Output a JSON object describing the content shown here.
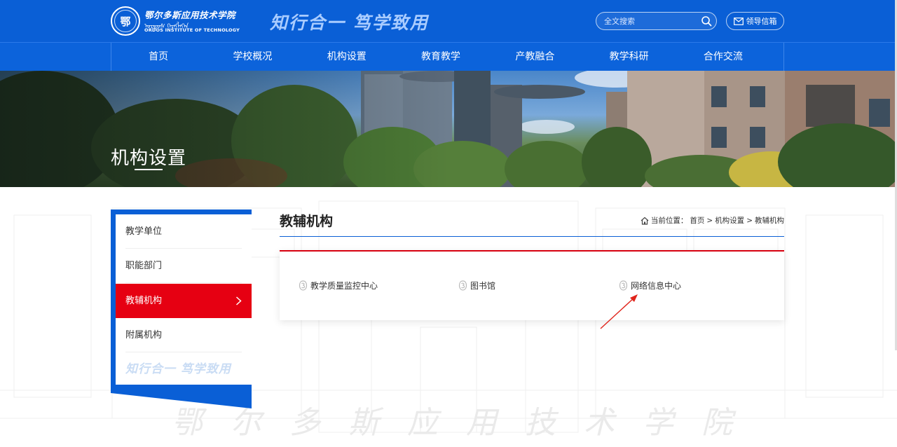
{
  "header": {
    "logo": {
      "emblem_char": "鄂",
      "name_cn": "鄂尔多斯应用技术学院",
      "name_mn": "ᠣᠷᠳᠣᠰ ᠬᠡᠷᠡᠭᠯᠡᠭᠡᠨ",
      "name_en": "ORDOS INSTITUTE OF TECHNOLOGY"
    },
    "slogan": "知行合一  笃学致用",
    "search": {
      "placeholder": "全文搜索"
    },
    "mailbox_label": "领导信箱"
  },
  "nav": {
    "items": [
      "首页",
      "学校概况",
      "机构设置",
      "教育教学",
      "产教融合",
      "教学科研",
      "合作交流"
    ]
  },
  "banner": {
    "title": "机构设置"
  },
  "sidebar": {
    "items": [
      {
        "label": "教学单位",
        "active": false
      },
      {
        "label": "职能部门",
        "active": false
      },
      {
        "label": "教辅机构",
        "active": true
      },
      {
        "label": "附属机构",
        "active": false
      }
    ],
    "slogan": "知行合一  笃学致用"
  },
  "content": {
    "title": "教辅机构",
    "breadcrumb": {
      "prefix": "当前位置：",
      "items": [
        "首页",
        "机构设置",
        "教辅机构"
      ],
      "separator": ">"
    },
    "units": [
      "教学质量监控中心",
      "图书馆",
      "网络信息中心"
    ]
  },
  "watermark_text": [
    "鄂",
    "尔",
    "多",
    "斯",
    "应",
    "用",
    "技",
    "术",
    "学",
    "院"
  ],
  "colors": {
    "brand_blue": "#0a5fd6",
    "nav_blue": "#0c63db",
    "active_red": "#e60012",
    "accent_red": "#d7000f"
  }
}
